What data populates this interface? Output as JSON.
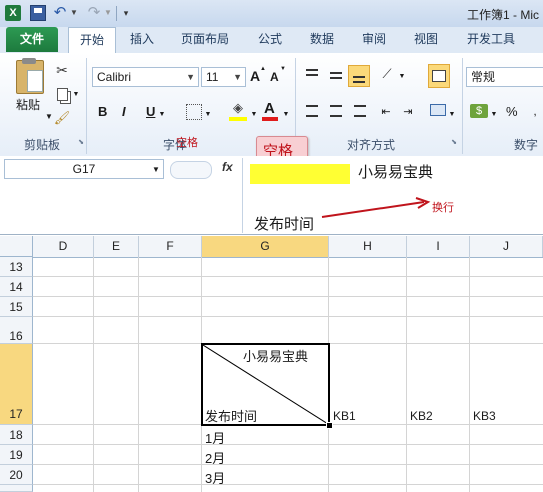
{
  "window": {
    "title": "工作簿1 - Mic"
  },
  "ribbon_tabs": [
    "文件",
    "开始",
    "插入",
    "页面布局",
    "公式",
    "数据",
    "审阅",
    "视图",
    "开发工具"
  ],
  "clipboard": {
    "paste_label": "粘贴",
    "group_label": "剪贴板"
  },
  "font": {
    "name": "Calibri",
    "size": "11",
    "group_label": "字体",
    "bold": "B",
    "italic": "I",
    "underline": "U",
    "grow_font": "A",
    "shrink_font": "A",
    "font_color": "A"
  },
  "alignment": {
    "group_label": "对齐方式"
  },
  "number": {
    "format": "常规",
    "group_label": "数字",
    "percent": "%"
  },
  "formula_bar": {
    "name_box": "G17",
    "fx": "fx",
    "line1": "小易易宝典",
    "line2": "发布时间"
  },
  "annotations": {
    "space": "空格",
    "line_break": "换行",
    "font_overlay": "空格"
  },
  "columns": [
    "D",
    "E",
    "F",
    "G",
    "H",
    "I",
    "J"
  ],
  "rows": [
    "13",
    "14",
    "15",
    "16",
    "17",
    "18",
    "19",
    "20"
  ],
  "cells": {
    "G17_top": "小易易宝典",
    "G17_bottom": "发布时间",
    "H17": "KB1",
    "I17": "KB2",
    "J17": "KB3",
    "G18": "1月",
    "G19": "2月",
    "G20": "3月"
  },
  "colors": {
    "file_tab": "#1d7a3d",
    "selection_border": "#000000",
    "annotation_red": "#c0141c",
    "highlight": "#ffff33"
  }
}
